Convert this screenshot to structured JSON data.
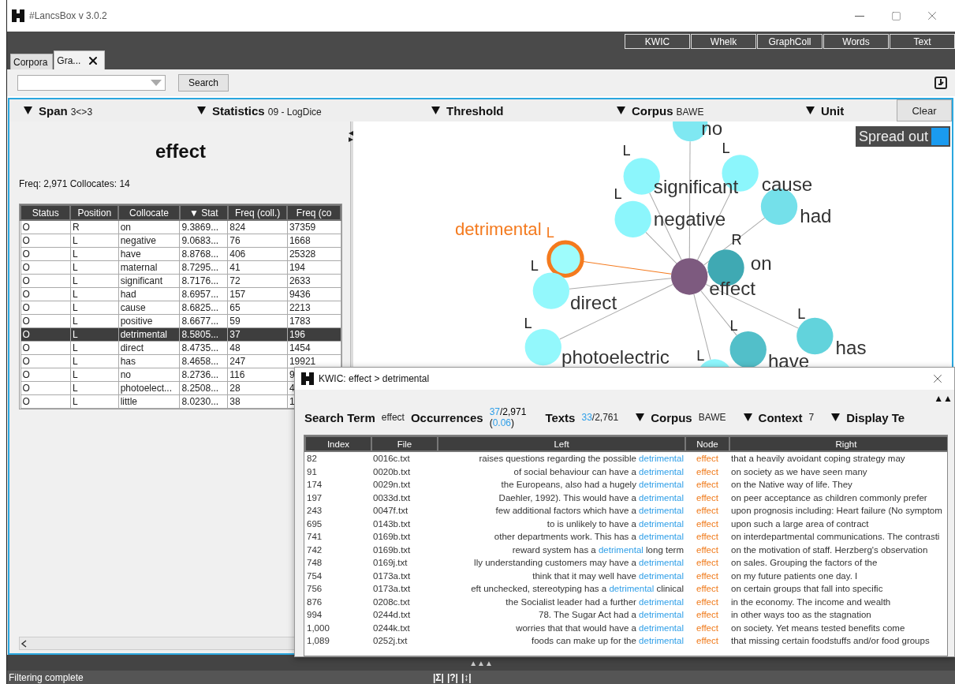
{
  "window": {
    "title": "#LancsBox v 3.0.2"
  },
  "tools": [
    "KWIC",
    "Whelk",
    "GraphColl",
    "Words",
    "Text"
  ],
  "tabs": [
    {
      "label": "Corpora",
      "selected": false,
      "closable": false
    },
    {
      "label": "Gra...",
      "selected": true,
      "closable": true
    }
  ],
  "search": {
    "button": "Search"
  },
  "filters": [
    {
      "label": "Span",
      "value": "3<>3"
    },
    {
      "label": "Statistics",
      "value": "09 - LogDice"
    },
    {
      "label": "Threshold"
    },
    {
      "label": "Corpus",
      "value": "BAWE"
    },
    {
      "label": "Unit"
    }
  ],
  "clear_button": "Clear",
  "node_word": "effect",
  "summary": "Freq: 2,971 Collocates: 14",
  "collocates": {
    "columns": [
      "Status",
      "Position",
      "Collocate",
      "▼ Stat",
      "Freq (coll.)",
      "Freq (co"
    ],
    "rows": [
      {
        "cells": [
          "O",
          "R",
          "on",
          "9.3869...",
          "824",
          "37359"
        ],
        "selected": false
      },
      {
        "cells": [
          "O",
          "L",
          "negative",
          "9.0683...",
          "76",
          "1668"
        ],
        "selected": false
      },
      {
        "cells": [
          "O",
          "L",
          "have",
          "8.8768...",
          "406",
          "25328"
        ],
        "selected": false
      },
      {
        "cells": [
          "O",
          "L",
          "maternal",
          "8.7295...",
          "41",
          "194"
        ],
        "selected": false
      },
      {
        "cells": [
          "O",
          "L",
          "significant",
          "8.7176...",
          "72",
          "2633"
        ],
        "selected": false
      },
      {
        "cells": [
          "O",
          "L",
          "had",
          "8.6957...",
          "157",
          "9436"
        ],
        "selected": false
      },
      {
        "cells": [
          "O",
          "L",
          "cause",
          "8.6825...",
          "65",
          "2213"
        ],
        "selected": false
      },
      {
        "cells": [
          "O",
          "L",
          "positive",
          "8.6677...",
          "59",
          "1783"
        ],
        "selected": false
      },
      {
        "cells": [
          "O",
          "L",
          "detrimental",
          "8.5805...",
          "37",
          "196"
        ],
        "selected": true
      },
      {
        "cells": [
          "O",
          "L",
          "direct",
          "8.4735...",
          "48",
          "1454"
        ],
        "selected": false
      },
      {
        "cells": [
          "O",
          "L",
          "has",
          "8.4658...",
          "247",
          "19921"
        ],
        "selected": false
      },
      {
        "cells": [
          "O",
          "L",
          "no",
          "8.2736...",
          "116",
          "9"
        ],
        "selected": false
      },
      {
        "cells": [
          "O",
          "L",
          "photoelect...",
          "8.2508...",
          "28",
          "4"
        ],
        "selected": false
      },
      {
        "cells": [
          "O",
          "L",
          "little",
          "8.0230...",
          "38",
          "1"
        ],
        "selected": false
      }
    ]
  },
  "graph": {
    "spread_out": {
      "label": "Spread out",
      "checked": true
    },
    "nodes": [
      {
        "kind": "collocate",
        "label": "no",
        "color": "#7fe8f2",
        "selected": false
      },
      {
        "kind": "collocate",
        "label": "significant",
        "position": "L",
        "color": "#8cf6fc",
        "selected": false
      },
      {
        "kind": "collocate",
        "label": "cause",
        "position": "L",
        "color": "#8cf6fc",
        "selected": false
      },
      {
        "kind": "collocate",
        "label": "negative",
        "position": "L",
        "color": "#8cf6fc",
        "selected": false
      },
      {
        "kind": "collocate",
        "label": "had",
        "color": "#74e0ea",
        "selected": false
      },
      {
        "kind": "collocate",
        "label": "on",
        "position": "R",
        "color": "#3fa9b3",
        "selected": false
      },
      {
        "kind": "collocate",
        "label": "detrimental",
        "position": "L",
        "color": "#9efcfc",
        "selected": true
      },
      {
        "kind": "collocate",
        "label": "direct",
        "position": "L",
        "color": "#93f8fc",
        "selected": false
      },
      {
        "kind": "center",
        "label": "effect",
        "color": "#7d5a7f",
        "selected": false
      },
      {
        "kind": "collocate",
        "label": "photoelectric",
        "position": "L",
        "color": "#93f8fc",
        "selected": false
      },
      {
        "kind": "collocate",
        "label": "have",
        "position": "L",
        "color": "#52bfc9",
        "selected": false
      },
      {
        "kind": "collocate",
        "label": "has",
        "position": "L",
        "color": "#62d3dc",
        "selected": false
      },
      {
        "kind": "collocate",
        "position": "L",
        "color": "#8cf6fc",
        "selected": false
      }
    ]
  },
  "kwic": {
    "title": "KWIC: effect > detrimental",
    "collapse": "▲▲",
    "search_term": {
      "label": "Search Term",
      "value": "effect"
    },
    "occurrences": {
      "label": "Occurrences",
      "hits": "37",
      "total": "/2,971",
      "relative_open": "(",
      "relative": "0.06",
      "relative_close": ")"
    },
    "texts": {
      "label": "Texts",
      "hits": "33",
      "total": "/2,761"
    },
    "corpus": {
      "label": "Corpus",
      "value": "BAWE"
    },
    "context": {
      "label": "Context",
      "value": "7"
    },
    "display": {
      "label": "Display Te"
    },
    "columns": [
      "Index",
      "File",
      "Left",
      "Node",
      "Right"
    ],
    "rows": [
      {
        "index": "82",
        "file": "0016c.txt",
        "left": "raises questions regarding the possible",
        "collocate": "detrimental",
        "node": "effect",
        "right": "that a heavily avoidant coping strategy may"
      },
      {
        "index": "91",
        "file": "0020b.txt",
        "left": "of social behaviour can have a",
        "collocate": "detrimental",
        "node": "effect",
        "right": "on society as we have seen many"
      },
      {
        "index": "174",
        "file": "0029n.txt",
        "left": "the Europeans, also had a hugely",
        "collocate": "detrimental",
        "node": "effect",
        "right": "on the Native way of life. They"
      },
      {
        "index": "197",
        "file": "0033d.txt",
        "left": "Daehler, 1992). This would have a",
        "collocate": "detrimental",
        "node": "effect",
        "right": "on peer acceptance as children commonly prefer"
      },
      {
        "index": "243",
        "file": "0047f.txt",
        "left": "few additional factors which have a",
        "collocate": "detrimental",
        "node": "effect",
        "right": "upon prognosis including: Heart failure (No symptom"
      },
      {
        "index": "695",
        "file": "0143b.txt",
        "left": "to is unlikely to have a",
        "collocate": "detrimental",
        "node": "effect",
        "right": "upon such a large area of contract"
      },
      {
        "index": "741",
        "file": "0169b.txt",
        "left": "other departments work. This has a",
        "collocate": "detrimental",
        "node": "effect",
        "right": "on interdepartmental communications. The contrasti"
      },
      {
        "index": "742",
        "file": "0169b.txt",
        "left": "reward system has a",
        "collocate": "detrimental",
        "left_tail": "long term",
        "node": "effect",
        "right": "on the motivation of staff. Herzberg's observation"
      },
      {
        "index": "748",
        "file": "0169j.txt",
        "left": "lly understanding customers may have a",
        "collocate": "detrimental",
        "node": "effect",
        "right": "on sales. Grouping the factors of the"
      },
      {
        "index": "754",
        "file": "0173a.txt",
        "left": "think that it may well have",
        "collocate": "detrimental",
        "node": "effect",
        "right": "on my future patients one day. I"
      },
      {
        "index": "756",
        "file": "0173a.txt",
        "left": "eft unchecked, stereotyping has a",
        "collocate": "detrimental",
        "left_tail": "clinical",
        "node": "effect",
        "right": "on certain groups that fall into specific"
      },
      {
        "index": "876",
        "file": "0208c.txt",
        "left": "the Socialist leader had a further",
        "collocate": "detrimental",
        "node": "effect",
        "right": "in the economy. The income and wealth"
      },
      {
        "index": "994",
        "file": "0244d.txt",
        "left": "78. The Sugar Act had a",
        "collocate": "detrimental",
        "node": "effect",
        "right": "in other ways too as the stagnation"
      },
      {
        "index": "1,000",
        "file": "0244k.txt",
        "left": "worries that that would have a",
        "collocate": "detrimental",
        "node": "effect",
        "right": "on society. Yet means tested benefits come"
      },
      {
        "index": "1,089",
        "file": "0252j.txt",
        "left": "foods can make up for the",
        "collocate": "detrimental",
        "node": "effect",
        "right": "that missing certain foodstuffs and/or food groups"
      }
    ]
  },
  "bottom_handle": "▲▲▲",
  "status_bar": {
    "message": "Filtering complete",
    "buttons": [
      "|Σ|",
      "|?|",
      "|↕|"
    ]
  }
}
